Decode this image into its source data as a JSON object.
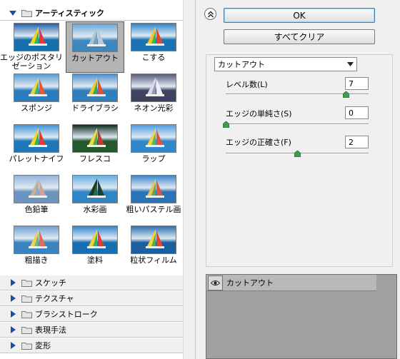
{
  "gallery": {
    "open_folder": "アーティスティック",
    "filters": [
      {
        "label": "エッジのポスタリゼーション",
        "style": "poster"
      },
      {
        "label": "カットアウト",
        "style": "cutout",
        "selected": true
      },
      {
        "label": "こする",
        "style": "smudge"
      },
      {
        "label": "スポンジ",
        "style": "sponge"
      },
      {
        "label": "ドライブラシ",
        "style": "drybrush"
      },
      {
        "label": "ネオン光彩",
        "style": "neon"
      },
      {
        "label": "パレットナイフ",
        "style": "palette"
      },
      {
        "label": "フレスコ",
        "style": "fresco"
      },
      {
        "label": "ラップ",
        "style": "wrap"
      },
      {
        "label": "色鉛筆",
        "style": "pencil"
      },
      {
        "label": "水彩画",
        "style": "watercolor"
      },
      {
        "label": "粗いパステル画",
        "style": "pastel"
      },
      {
        "label": "粗描き",
        "style": "rough"
      },
      {
        "label": "塗料",
        "style": "paint"
      },
      {
        "label": "粒状フィルム",
        "style": "grain"
      }
    ],
    "closed_folders": [
      "スケッチ",
      "テクスチャ",
      "ブラシストローク",
      "表現手法",
      "変形"
    ]
  },
  "buttons": {
    "ok": "OK",
    "clear_all": "すべてクリア"
  },
  "filter": {
    "selected": "カットアウト",
    "params": [
      {
        "label": "レベル数(L)",
        "value": "7",
        "fraction": 0.84
      },
      {
        "label": "エッジの単純さ(S)",
        "value": "0",
        "fraction": 0.0
      },
      {
        "label": "エッジの正確さ(F)",
        "value": "2",
        "fraction": 0.5
      }
    ]
  },
  "layer": {
    "name": "カットアウト"
  },
  "icons": {
    "collapse": "double-chevron-up-icon",
    "disclosure_open": "triangle-down-icon",
    "disclosure_closed": "triangle-right-icon",
    "folder": "folder-icon",
    "eye": "eye-icon",
    "dropdown": "chevron-down-icon"
  },
  "colors": {
    "accent_blue": "#3c7fb1",
    "slider_knob": "#3f9a52",
    "disclosure_arrow": "#1c4f9c",
    "panel_gray": "#a0a0a0"
  }
}
